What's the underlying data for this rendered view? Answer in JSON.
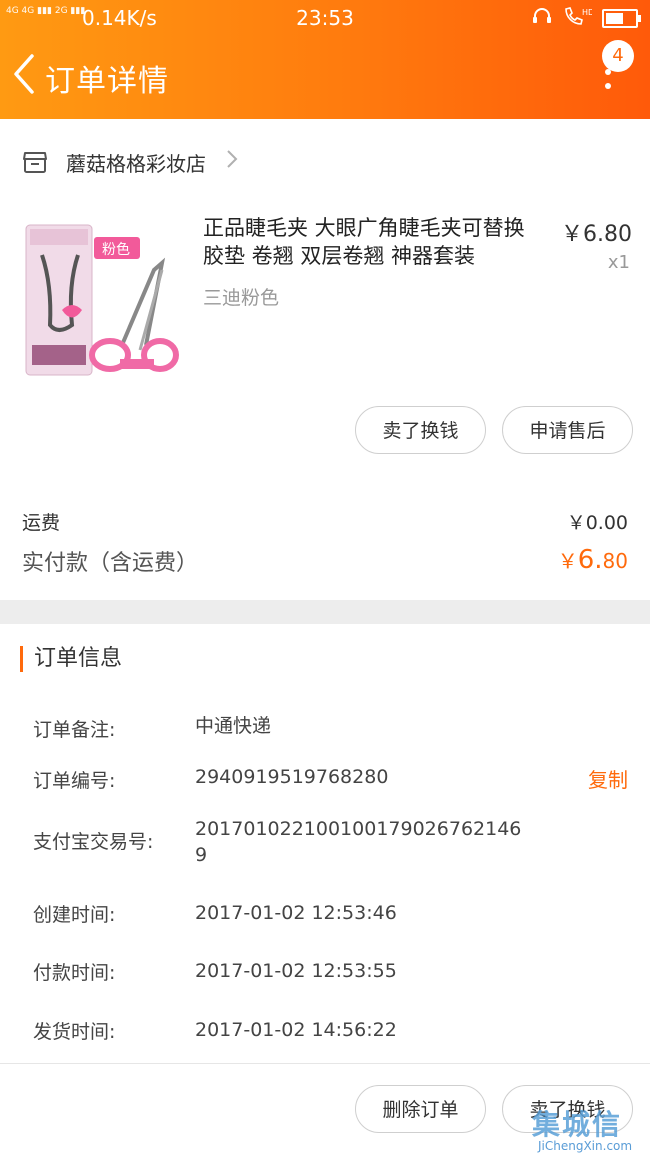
{
  "status_bar": {
    "net_left": "4G 4G",
    "net_right": "2G",
    "speed": "0.14K/s",
    "time": "23:53",
    "hd": "HD",
    "battery_percent": 60
  },
  "header": {
    "title": "订单详情",
    "badge_count": "4"
  },
  "shop": {
    "name": "蘑菇格格彩妆店"
  },
  "product": {
    "title": "正品睫毛夹 大眼广角睫毛夹可替换胶垫 卷翘 双层卷翘 神器套装",
    "price": "￥6.80",
    "qty": "x1",
    "sku": "三迪粉色",
    "image_tag": "粉色"
  },
  "item_actions": {
    "sell": "卖了换钱",
    "after_sale": "申请售后"
  },
  "summary": {
    "shipping_label": "运费",
    "shipping_value": "￥0.00",
    "paid_label": "实付款（含运费）",
    "paid_currency": "￥",
    "paid_int": "6.",
    "paid_dec": "80"
  },
  "order_info": {
    "title": "订单信息",
    "note_label": "订单备注:",
    "note_value": "中通快递",
    "number_label": "订单编号:",
    "number_value": "2940919519768280",
    "copy": "复制",
    "alipay_label": "支付宝交易号:",
    "alipay_value": "20170102210010017902676214 6 9",
    "created_label": "创建时间:",
    "created_value": "2017-01-02 12:53:46",
    "paid_label": "付款时间:",
    "paid_value": "2017-01-02 12:53:55",
    "shipped_label": "发货时间:",
    "shipped_value": "2017-01-02 14:56:22"
  },
  "bottom_actions": {
    "delete": "删除订单",
    "sell": "卖了换钱"
  },
  "watermark": {
    "zh": "集城信",
    "en": "JiChengXin.com"
  },
  "colors": {
    "accent": "#ff6a0c",
    "header_start": "#ff9a12",
    "header_end": "#ff5a0a"
  }
}
